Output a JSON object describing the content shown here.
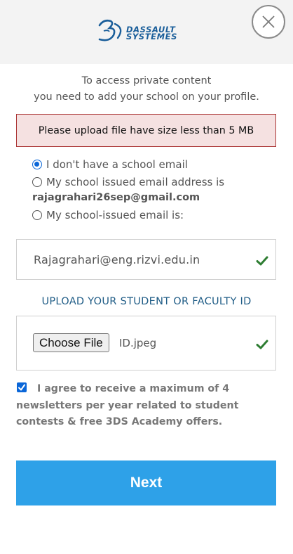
{
  "header": {
    "logo_line1": "DASSAULT",
    "logo_line2": "SYSTEMES"
  },
  "intro": {
    "line1": "To access private content",
    "line2": "you need to add your school on your profile."
  },
  "alert": {
    "text": "Please upload file have size less than 5 MB"
  },
  "options": {
    "no_school_email": "I don't have a school email",
    "issued_email_label": "My school issued email address is",
    "issued_email_value": "rajagrahari26sep@gmail.com",
    "school_email_label": "My school-issued email is:",
    "selected": "no_school_email"
  },
  "email_field": {
    "value": "Rajagrahari@eng.rizvi.edu.in"
  },
  "upload": {
    "label": "UPLOAD YOUR STUDENT OR FACULTY ID",
    "button": "Choose File",
    "filename": "ID.jpeg"
  },
  "agree": {
    "text": "I agree to receive a maximum of 4 newsletters per year related to student contests & free 3DS Academy offers.",
    "checked": true
  },
  "next_button": "Next",
  "icons": {
    "close": "close-icon",
    "check": "check-icon",
    "logo": "3ds-logo-icon"
  },
  "colors": {
    "accent": "#2ea1e8",
    "logo": "#1a5e9a",
    "check": "#2e7d32",
    "alert_bg": "#f5e1e1",
    "alert_border": "#aa3333"
  }
}
